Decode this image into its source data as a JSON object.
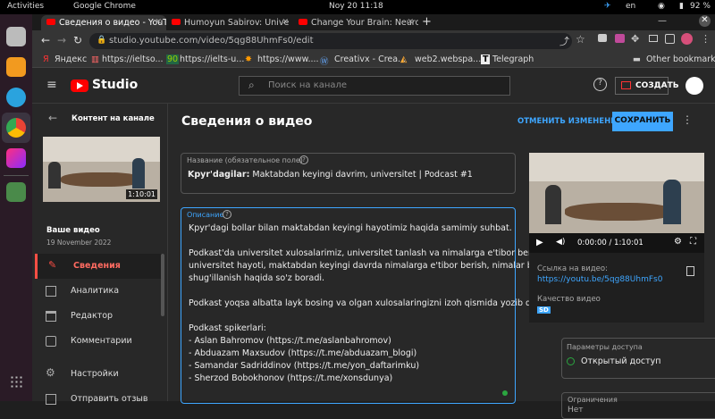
{
  "os": {
    "activities": "Activities",
    "app_name": "Google Chrome",
    "date_time": "Noy 20  11:18",
    "lang": "en",
    "battery": "92 %"
  },
  "browser": {
    "tabs": [
      {
        "label": "Сведения о видео - YouT"
      },
      {
        "label": "Humoyun Sabirov: Unive"
      },
      {
        "label": "Change Your Brain: Neuro"
      }
    ],
    "new_tab": "+",
    "url": "studio.youtube.com/video/5qg88UhmFs0/edit",
    "bookmarks": [
      {
        "label": "Яндекс"
      },
      {
        "label": "https://ieltso..."
      },
      {
        "label": "https://ielts-u..."
      },
      {
        "label": "https://www...."
      },
      {
        "label": "Creativx - Crea..."
      },
      {
        "label": "web2.webspa..."
      },
      {
        "label": "Telegraph"
      }
    ],
    "other_bookmarks": "Other bookmarks"
  },
  "studio": {
    "logo": "Studio",
    "search_placeholder": "Поиск на канале",
    "create_label": "СОЗДАТЬ",
    "help": "?"
  },
  "sidebar": {
    "back_label": "Контент на канале",
    "thumb_duration": "1:10:01",
    "your_video": "Ваше видео",
    "date": "19 November 2022",
    "items": [
      {
        "label": "Сведения"
      },
      {
        "label": "Аналитика"
      },
      {
        "label": "Редактор"
      },
      {
        "label": "Комментарии"
      },
      {
        "label": "Настройки"
      },
      {
        "label": "Отправить отзыв"
      }
    ]
  },
  "main": {
    "title": "Сведения о видео",
    "undo_label": "ОТМЕНИТЬ ИЗМЕНЕНИЯ",
    "save_label": "СОХРАНИТЬ",
    "title_field_label": "Название (обязательное поле)",
    "title_value_bold": "Kрyr'dagilar:",
    "title_value_rest": " Maktabdan keyingi davrim, universitet | Podcast #1",
    "desc_field_label": "Описание",
    "desc_lines": [
      "Kрyr'dagi bollar bilan maktabdan keyingi hayotimiz haqida samimiy suhbat.",
      "",
      "Podkast'da universitet xulosalarimiz, universitet tanlash va nimalarga e'tibor berish kerak,",
      "universitet hayoti, maktabdan keyingi davrda nimalarga e'tibor berish, nimalar bilan",
      "shug'illanish haqida so'z boradi.",
      "",
      "Podkast yoqsa albatta layk bosing va olgan xulosalaringizni izoh qismida yozib qoldiring.",
      "",
      "Podkast spikerlari:",
      "- Aslan Bahromov (https://t.me/aslanbahromov)",
      "- Abduazam Maxsudov (https://t.me/abduazam_blogi)",
      "- Samandar Sadriddinov (https://t.me/yon_daftarimku)",
      "- Sherzod Bobokhonov (https://t.me/xonsdunya)"
    ]
  },
  "right_panel": {
    "player_time": "0:00:00 / 1:10:01",
    "link_label": "Ссылка на видео:",
    "link_value": "https://youtu.be/5qg88UhmFs0",
    "quality_label": "Качество видео",
    "quality_badge": "SD",
    "access_label": "Параметры доступа",
    "access_value": "Открытый доступ",
    "restrictions_label": "Ограничения",
    "restrictions_value": "Нет"
  },
  "colors": {
    "accent_blue": "#3ea6ff",
    "youtube_red": "#ff0000",
    "active_nav": "#ff4e45",
    "access_green": "#2ba640"
  }
}
